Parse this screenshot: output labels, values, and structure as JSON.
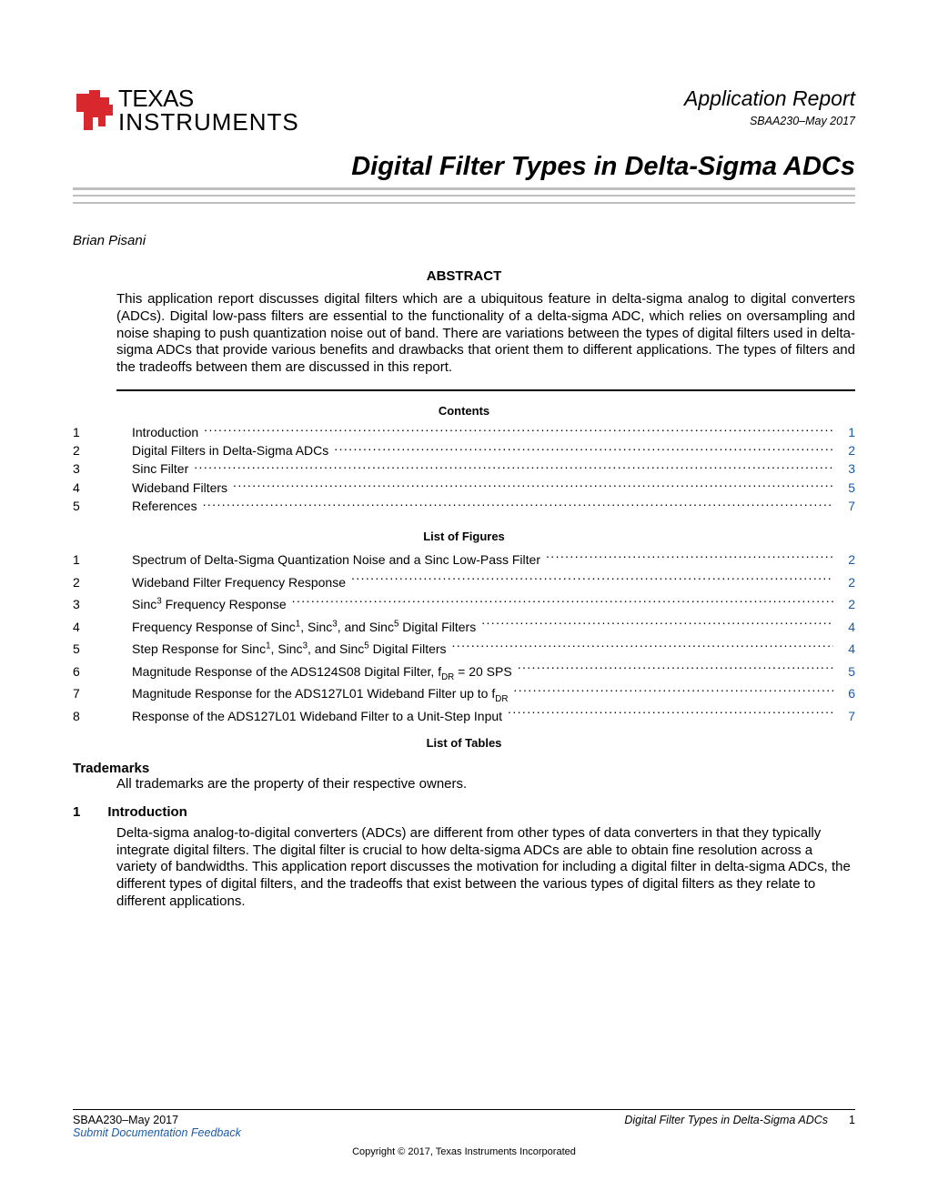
{
  "header": {
    "company_line1": "TEXAS",
    "company_line2": "INSTRUMENTS",
    "app_report": "Application Report",
    "doc_id": "SBAA230–May 2017"
  },
  "title": "Digital Filter Types in Delta-Sigma ADCs",
  "author": "Brian Pisani",
  "abstract_label": "ABSTRACT",
  "abstract": "This application report discusses digital filters which are a ubiquitous feature in delta-sigma analog to digital converters (ADCs). Digital low-pass filters are essential to the functionality of a delta-sigma ADC, which relies on oversampling and noise shaping to push quantization noise out of band. There are variations between the types of digital filters used in delta-sigma ADCs that provide various benefits and drawbacks that orient them to different applications. The types of filters and the tradeoffs between them are discussed in this report.",
  "contents_label": "Contents",
  "toc": [
    {
      "num": "1",
      "label": "Introduction",
      "page": "1"
    },
    {
      "num": "2",
      "label": "Digital Filters in Delta-Sigma ADCs",
      "page": "2"
    },
    {
      "num": "3",
      "label": "Sinc Filter",
      "page": "3"
    },
    {
      "num": "4",
      "label": "Wideband Filters",
      "page": "5"
    },
    {
      "num": "5",
      "label": "References",
      "page": "7"
    }
  ],
  "lof_label": "List of Figures",
  "lof": [
    {
      "num": "1",
      "label_html": "Spectrum of Delta-Sigma Quantization Noise and a Sinc Low-Pass Filter",
      "page": "2"
    },
    {
      "num": "2",
      "label_html": "Wideband Filter Frequency Response",
      "page": "2"
    },
    {
      "num": "3",
      "label_html": "Sinc<span class=\"sup\">3</span> Frequency Response",
      "page": "2"
    },
    {
      "num": "4",
      "label_html": "Frequency Response of Sinc<span class=\"sup\">1</span>, Sinc<span class=\"sup\">3</span>, and Sinc<span class=\"sup\">5</span> Digital Filters",
      "page": "4"
    },
    {
      "num": "5",
      "label_html": "Step Response for Sinc<span class=\"sup\">1</span>, Sinc<span class=\"sup\">3</span>, and Sinc<span class=\"sup\">5</span> Digital Filters",
      "page": "4"
    },
    {
      "num": "6",
      "label_html": "Magnitude Response of the ADS124S08 Digital Filter, f<span class=\"sub\">DR</span> = 20 SPS",
      "page": "5"
    },
    {
      "num": "7",
      "label_html": "Magnitude Response for the ADS127L01 Wideband Filter up to f<span class=\"sub\">DR</span>",
      "page": "6"
    },
    {
      "num": "8",
      "label_html": "Response of the ADS127L01 Wideband Filter to a Unit-Step Input",
      "page": "7"
    }
  ],
  "lot_label": "List of Tables",
  "trademarks_heading": "Trademarks",
  "trademarks_text": "All trademarks are the property of their respective owners.",
  "section1_num": "1",
  "section1_heading": "Introduction",
  "section1_body": "Delta-sigma analog-to-digital converters (ADCs) are different from other types of data converters in that they typically integrate digital filters. The digital filter is crucial to how delta-sigma ADCs are able to obtain fine resolution across a variety of bandwidths. This application report discusses the motivation for including a digital filter in delta-sigma ADCs, the different types of digital filters, and the tradeoffs that exist between the various types of digital filters as they relate to different applications.",
  "footer": {
    "left": "SBAA230–May 2017",
    "feedback": "Submit Documentation Feedback",
    "center": "Digital Filter Types in Delta-Sigma ADCs",
    "page": "1",
    "copyright": "Copyright © 2017, Texas Instruments Incorporated"
  }
}
